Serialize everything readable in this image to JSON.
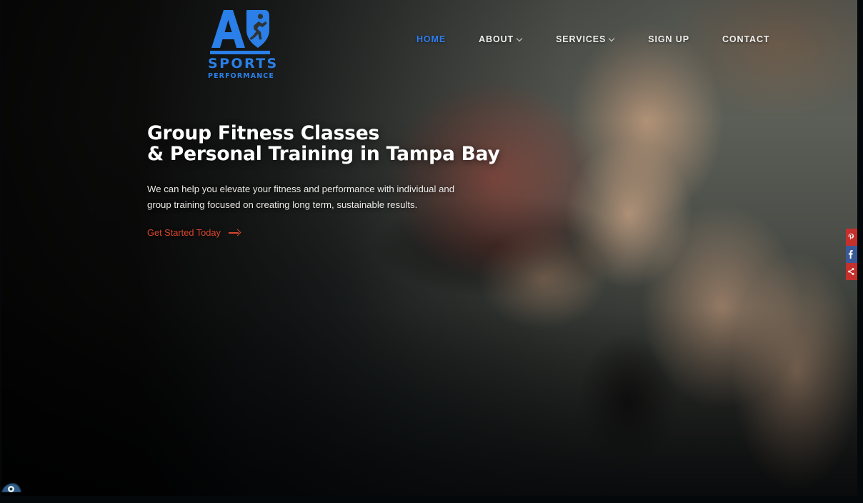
{
  "site": {
    "logo": {
      "mark_letters": "AB",
      "line1": "SPORTS",
      "line2": "PERFORMANCE",
      "color": "#2a7fe8",
      "icon": "ab-sports-performance-logo"
    }
  },
  "nav": {
    "items": [
      {
        "label": "HOME",
        "active": true,
        "has_dropdown": false
      },
      {
        "label": "ABOUT",
        "active": false,
        "has_dropdown": true
      },
      {
        "label": "SERVICES",
        "active": false,
        "has_dropdown": true
      },
      {
        "label": "SIGN UP",
        "active": false,
        "has_dropdown": false
      },
      {
        "label": "CONTACT",
        "active": false,
        "has_dropdown": false
      }
    ],
    "active_color": "#2f7df0",
    "text_color": "#f0f0ee"
  },
  "hero": {
    "title_line1": "Group Fitness Classes",
    "title_line2": "& Personal Training in Tampa Bay",
    "subtitle": "We can help you elevate your fitness and performance with individual and group training focused on creating long term, sustainable results.",
    "cta_label": "Get Started Today",
    "cta_icon": "arrow-right-icon",
    "cta_color": "#d9462c",
    "title_color": "#ffffff"
  },
  "social_rail": {
    "buttons": [
      {
        "name": "pinterest",
        "icon": "pinterest-icon",
        "color": "#c4302b"
      },
      {
        "name": "facebook",
        "icon": "facebook-icon",
        "color": "#3b5998"
      },
      {
        "name": "share",
        "icon": "share-icon",
        "color": "#c4302b"
      }
    ]
  },
  "accessibility": {
    "icon": "accessibility-eye-icon",
    "label": ""
  }
}
